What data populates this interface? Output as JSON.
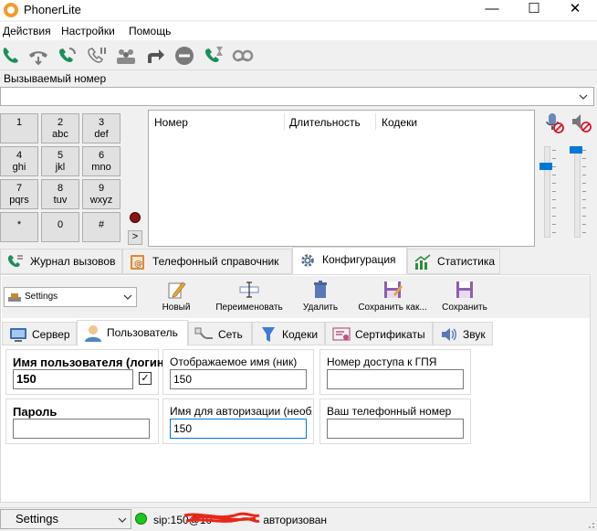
{
  "window": {
    "title": "PhonerLite",
    "minimize": "—",
    "maximize": "☐",
    "close": "✕"
  },
  "menu": [
    "Действия",
    "Настройки",
    "Помощь"
  ],
  "called_number": {
    "label": "Вызываемый номер",
    "value": "",
    "dropdown_icon": "chevron-down-icon"
  },
  "dialpad": [
    {
      "digit": "1",
      "letters": ""
    },
    {
      "digit": "2",
      "letters": "abc"
    },
    {
      "digit": "3",
      "letters": "def"
    },
    {
      "digit": "4",
      "letters": "ghi"
    },
    {
      "digit": "5",
      "letters": "jkl"
    },
    {
      "digit": "6",
      "letters": "mno"
    },
    {
      "digit": "7",
      "letters": "pqrs"
    },
    {
      "digit": "8",
      "letters": "tuv"
    },
    {
      "digit": "9",
      "letters": "wxyz"
    },
    {
      "digit": "*",
      "letters": ""
    },
    {
      "digit": "0",
      "letters": ""
    },
    {
      "digit": "#",
      "letters": ""
    }
  ],
  "dialpad_more": ">",
  "calls_table": {
    "columns": [
      "Номер",
      "Длительность",
      "Кодеки"
    ],
    "rows": []
  },
  "volume": {
    "microphone_level": 0.8,
    "speaker_level": 1.0
  },
  "main_tabs": [
    {
      "label": "Журнал вызовов",
      "icon": "call-log-icon",
      "active": false
    },
    {
      "label": "Телефонный справочник",
      "icon": "phonebook-icon",
      "active": false
    },
    {
      "label": "Конфигурация",
      "icon": "gear-icon",
      "active": true
    },
    {
      "label": "Статистика",
      "icon": "chart-icon",
      "active": false
    }
  ],
  "config_toolbar": {
    "profile": "Settings",
    "buttons": [
      "Новый",
      "Переименовать",
      "Удалить",
      "Сохранить как...",
      "Сохранить"
    ]
  },
  "sub_tabs": [
    {
      "label": "Сервер",
      "active": false
    },
    {
      "label": "Пользователь",
      "active": true
    },
    {
      "label": "Сеть",
      "active": false
    },
    {
      "label": "Кодеки",
      "active": false
    },
    {
      "label": "Сертификаты",
      "active": false
    },
    {
      "label": "Звук",
      "active": false
    }
  ],
  "user_form": {
    "username_label": "Имя пользователя (логин)",
    "username_value": "150",
    "username_checked": true,
    "display_name_label": "Отображаемое имя (ник)",
    "display_name_value": "150",
    "pstn_label": "Номер доступа к ГПЯ",
    "pstn_value": "",
    "password_label": "Пароль",
    "password_value": "",
    "auth_name_label": "Имя для авторизации (необязательно)",
    "auth_name_value": "150",
    "phone_number_label": "Ваш телефонный номер",
    "phone_number_value": ""
  },
  "status": {
    "profile": "Settings",
    "prefix": "sip:150@10",
    "suffix": "авторизован",
    "color": "#1ec51e"
  }
}
